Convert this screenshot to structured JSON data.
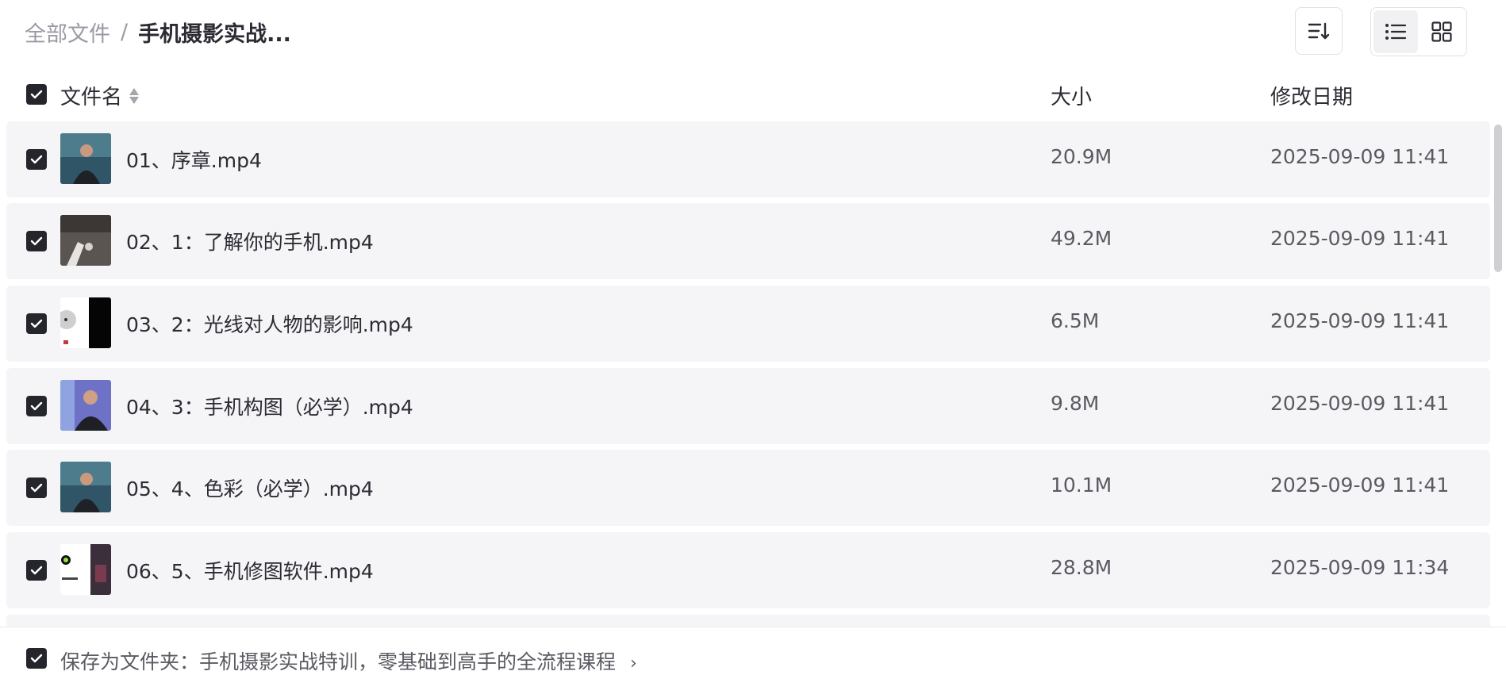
{
  "breadcrumb": {
    "root": "全部文件",
    "separator": "/",
    "current": "手机摄影实战..."
  },
  "toolbar": {
    "sort_icon": "sort-icon",
    "list_view_icon": "list-view-icon",
    "grid_view_icon": "grid-view-icon",
    "active_view": "list"
  },
  "table": {
    "headers": {
      "name": "文件名",
      "size": "大小",
      "date": "修改日期"
    },
    "rows": [
      {
        "name": "01、序章.mp4",
        "size": "20.9M",
        "date": "2025-09-09 11:41",
        "checked": true
      },
      {
        "name": "02、1：了解你的手机.mp4",
        "size": "49.2M",
        "date": "2025-09-09 11:41",
        "checked": true
      },
      {
        "name": "03、2：光线对人物的影响.mp4",
        "size": "6.5M",
        "date": "2025-09-09 11:41",
        "checked": true
      },
      {
        "name": "04、3：手机构图（必学）.mp4",
        "size": "9.8M",
        "date": "2025-09-09 11:41",
        "checked": true
      },
      {
        "name": "05、4、色彩（必学）.mp4",
        "size": "10.1M",
        "date": "2025-09-09 11:41",
        "checked": true
      },
      {
        "name": "06、5、手机修图软件.mp4",
        "size": "28.8M",
        "date": "2025-09-09 11:34",
        "checked": true
      }
    ]
  },
  "footer": {
    "save_label": "保存为文件夹：手机摄影实战特训，零基础到高手的全流程课程",
    "checked": true
  },
  "colors": {
    "checkbox": "#25252c",
    "row_bg": "#f5f5f7",
    "muted": "#9a9aa3"
  }
}
